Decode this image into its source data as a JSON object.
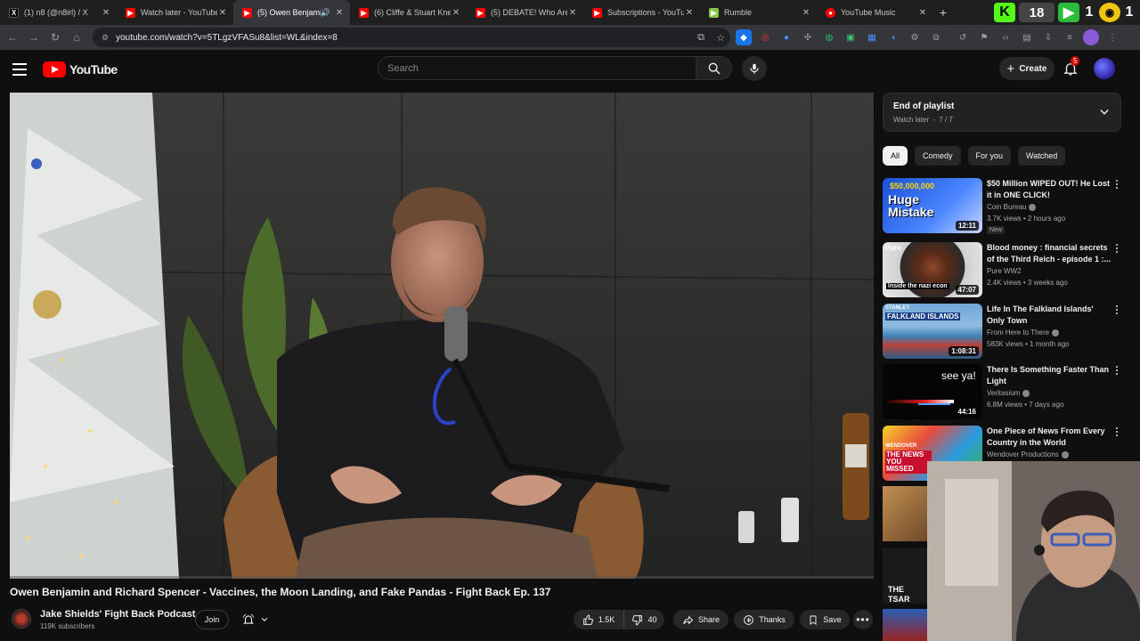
{
  "browser": {
    "tabs": [
      {
        "title": "(1) n8 (@n8irl) / X",
        "favicon": "x-logo-icon",
        "color": "#000000",
        "active": false
      },
      {
        "title": "Watch later - YouTube",
        "favicon": "youtube-icon",
        "color": "#ff0000",
        "active": false
      },
      {
        "title": "(5) Owen Benjamin",
        "favicon": "youtube-icon",
        "color": "#ff0000",
        "active": true
      },
      {
        "title": "(6) Cliffe & Stuart Knech",
        "favicon": "youtube-icon",
        "color": "#ff0000",
        "active": false
      },
      {
        "title": "(5) DEBATE! Who Are the",
        "favicon": "youtube-icon",
        "color": "#ff0000",
        "active": false
      },
      {
        "title": "Subscriptions - YouTube",
        "favicon": "youtube-icon",
        "color": "#ff0000",
        "active": false
      },
      {
        "title": "Rumble",
        "favicon": "rumble-icon",
        "color": "#85c742",
        "active": false
      },
      {
        "title": "YouTube Music",
        "favicon": "youtube-music-icon",
        "color": "#ff0000",
        "active": false
      }
    ],
    "tab_extras_text": "18",
    "url": "youtube.com/watch?v=5TLgzVFASu8&list=WL&index=8"
  },
  "header": {
    "logo_text": "YouTube",
    "search_placeholder": "Search",
    "create_label": "Create",
    "notification_count": "5"
  },
  "video": {
    "title": "Owen Benjamin and Richard Spencer - Vaccines, the Moon Landing, and Fake Pandas - Fight Back Ep. 137",
    "channel": "Jake Shields' Fight Back Podcast",
    "subscribers": "119K subscribers",
    "join_label": "Join",
    "likes": "1.5K",
    "dislikes": "40",
    "share_label": "Share",
    "thanks_label": "Thanks",
    "save_label": "Save"
  },
  "playlist": {
    "title": "End of playlist",
    "name": "Watch later",
    "position": "7 / 7"
  },
  "chips": [
    "All",
    "Comedy",
    "For you",
    "Watched"
  ],
  "recommendations": [
    {
      "title": "$50 Million WIPED OUT! He Lost it in ONE CLICK!",
      "channel": "Coin Bureau",
      "verified": true,
      "meta": "3.7K views • 2 hours ago",
      "badge": "New",
      "duration": "12:11",
      "thumb_text": "Huge Mistake",
      "thumb_top": "$50,000,000"
    },
    {
      "title": "Blood money : financial secrets of the Third Reich - episode 1 :...",
      "channel": "Pure WW2",
      "verified": false,
      "meta": "2.4K views • 3 weeks ago",
      "badge": "",
      "duration": "47:07",
      "thumb_text": "Inside the nazi econ",
      "thumb_top": "Pure"
    },
    {
      "title": "Life In The Falkland Islands' Only Town",
      "channel": "From Here to There",
      "verified": true,
      "meta": "583K views • 1 month ago",
      "badge": "",
      "duration": "1:08:31",
      "thumb_text": "FALKLAND ISLANDS",
      "thumb_top": "STANLEY"
    },
    {
      "title": "There Is Something Faster Than Light",
      "channel": "Veritasium",
      "verified": true,
      "meta": "6.8M views • 7 days ago",
      "badge": "",
      "duration": "44:16",
      "thumb_text": "see ya!",
      "thumb_top": ""
    },
    {
      "title": "One Piece of News From Every Country in the World",
      "channel": "Wendover Productions",
      "verified": true,
      "meta": "",
      "badge": "",
      "duration": "",
      "thumb_text": "THE NEWS YOU MISSED",
      "thumb_top": "WENDOVER"
    }
  ],
  "strip_text": "THE TSAR"
}
